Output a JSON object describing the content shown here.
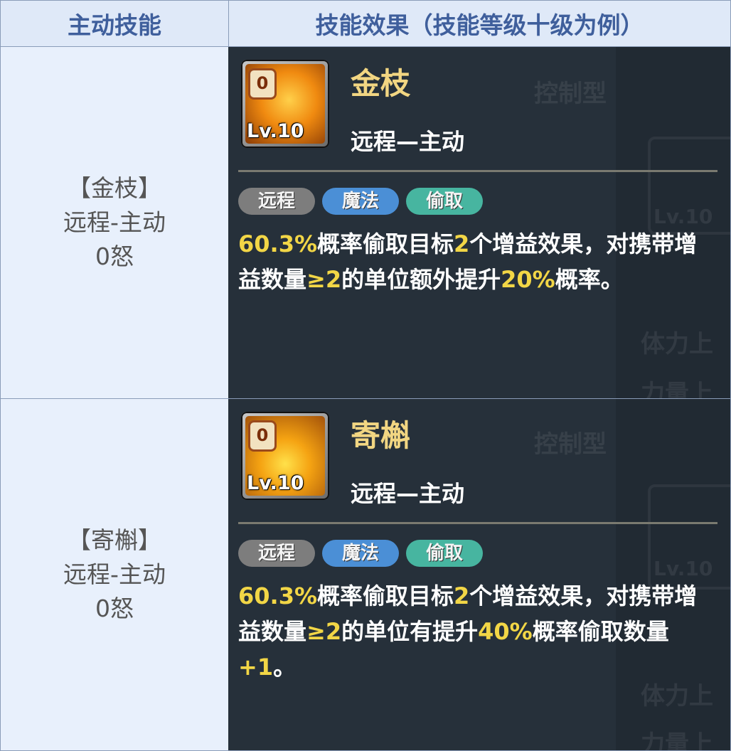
{
  "header": {
    "col1": "主动技能",
    "col2": "技能效果（技能等级十级为例）"
  },
  "rows": [
    {
      "left": {
        "name_line": "【金枝】",
        "type_line": "远程-主动",
        "cost_line": "0怒"
      },
      "card": {
        "badge": "0",
        "level": "Lv.10",
        "name": "金枝",
        "type": "远程—主动",
        "tags": [
          "远程",
          "魔法",
          "偷取"
        ],
        "desc": [
          {
            "text": "60.3%",
            "hl": true
          },
          {
            "text": "概率偷取目标",
            "hl": false
          },
          {
            "text": "2",
            "hl": true
          },
          {
            "text": "个增益效果，对携带增益数量",
            "hl": false
          },
          {
            "text": "≥2",
            "hl": true
          },
          {
            "text": "的单位额外提升",
            "hl": false
          },
          {
            "text": "20%",
            "hl": true
          },
          {
            "text": "概率。",
            "hl": false
          }
        ]
      }
    },
    {
      "left": {
        "name_line": "【寄槲】",
        "type_line": "远程-主动",
        "cost_line": "0怒"
      },
      "card": {
        "badge": "0",
        "level": "Lv.10",
        "name": "寄槲",
        "type": "远程—主动",
        "tags": [
          "远程",
          "魔法",
          "偷取"
        ],
        "desc": [
          {
            "text": "60.3%",
            "hl": true
          },
          {
            "text": "概率偷取目标",
            "hl": false
          },
          {
            "text": "2",
            "hl": true
          },
          {
            "text": "个增益效果，对携带增益数量",
            "hl": false
          },
          {
            "text": "≥2",
            "hl": true
          },
          {
            "text": "的单位有提升",
            "hl": false
          },
          {
            "text": "40%",
            "hl": true
          },
          {
            "text": "概率偷取数量",
            "hl": false
          },
          {
            "text": "+1",
            "hl": true
          },
          {
            "text": "。",
            "hl": false
          }
        ]
      }
    }
  ],
  "background_ghost": {
    "row1": [
      "控制型",
      "Lv.10",
      "体力上",
      "力量上"
    ],
    "row2": [
      "控制型",
      "Lv.10",
      "体力上",
      "力量上"
    ]
  },
  "colors": {
    "header_bg": "#dfe9f8",
    "header_text": "#3f5f9c",
    "left_bg": "#e8f0fc",
    "card_bg": "#26303a",
    "name_gold": "#f2d682",
    "highlight_yellow": "#f2d646",
    "tag_gray": "#7d7d7d",
    "tag_blue": "#4b8fd6",
    "tag_teal": "#47b5a0"
  }
}
